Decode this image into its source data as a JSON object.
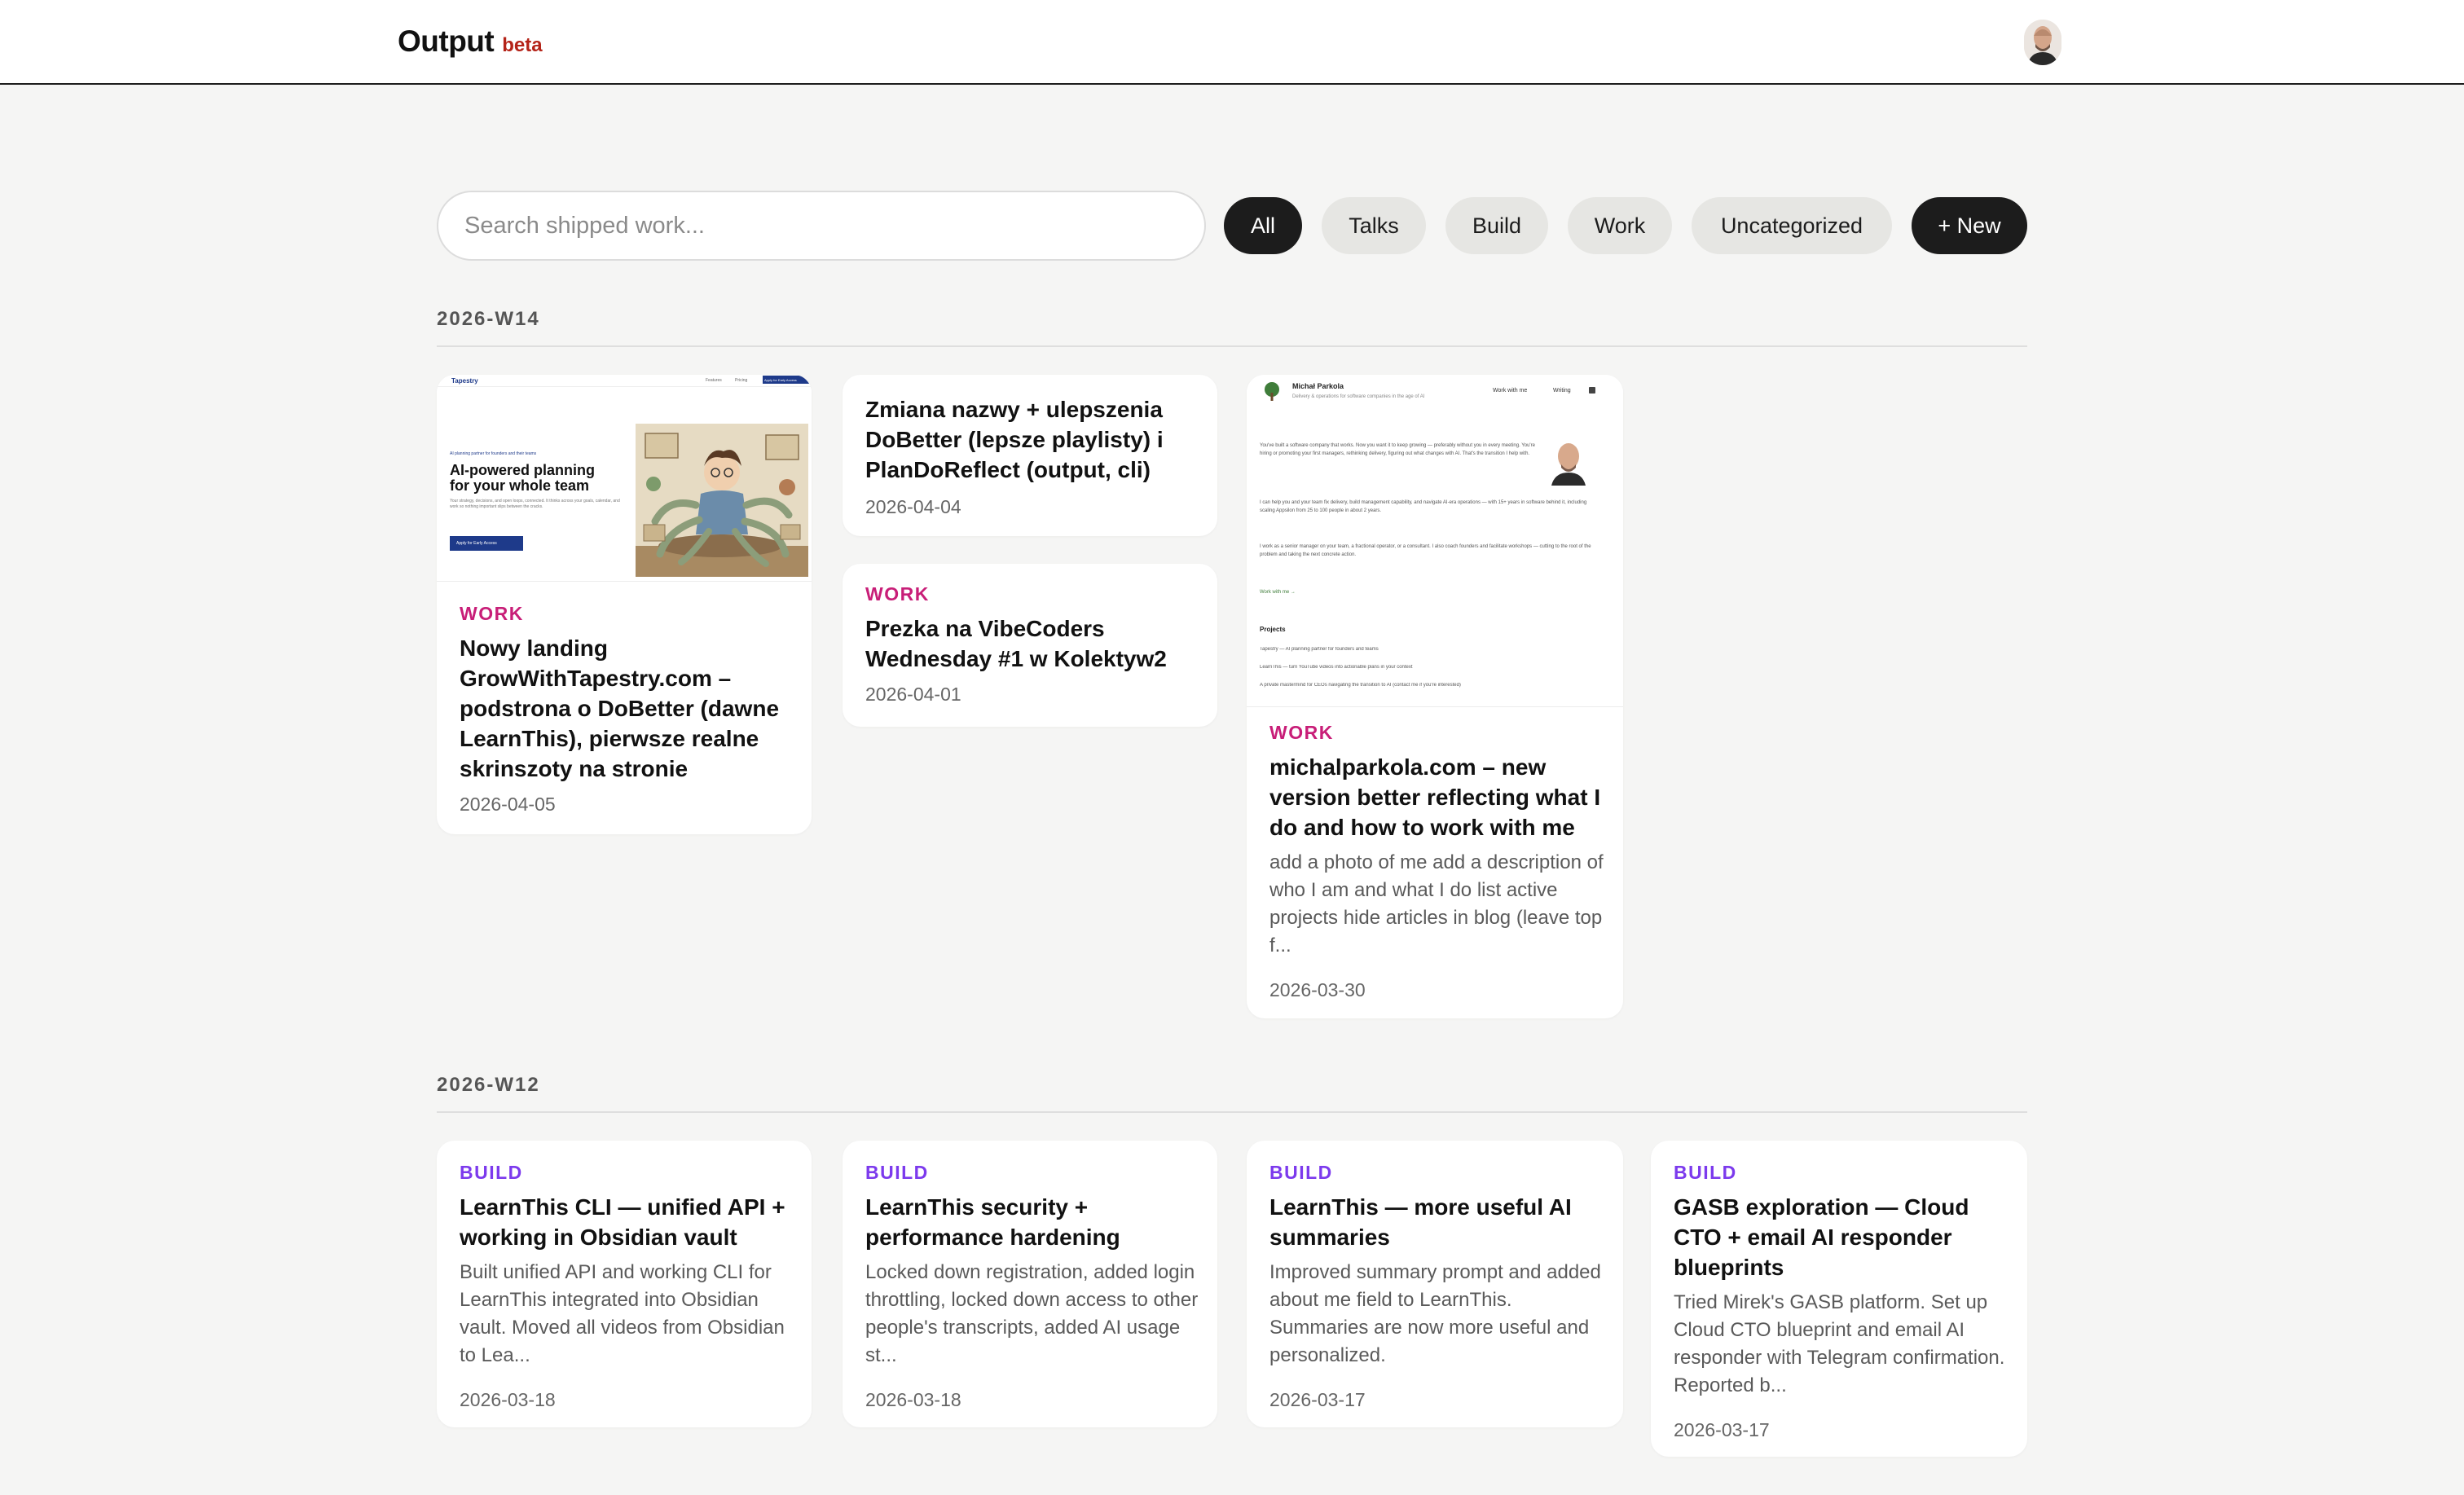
{
  "app": {
    "name": "Output",
    "badge": "beta"
  },
  "search": {
    "placeholder": "Search shipped work..."
  },
  "filters": [
    "All",
    "Talks",
    "Build",
    "Work",
    "Uncategorized"
  ],
  "new_button": "+ New",
  "colors": {
    "work": "#c81e78",
    "build": "#7c3aed",
    "active_chip": "#1c1c1c",
    "chip": "#e6e6e3",
    "beta": "#b42318"
  },
  "sections": [
    {
      "week": "2026-W14",
      "cards": [
        {
          "category": "WORK",
          "title": "Nowy landing GrowWithTapestry.com – podstrona o DoBetter (dawne LearnThis), pierwsze realne skrinszoty na stronie",
          "date": "2026-04-05",
          "thumbnail": {
            "brand": "Tapestry",
            "nav": [
              "Features",
              "Pricing",
              "Apply for Early Access"
            ],
            "eyebrow": "AI planning partner for founders and their teams",
            "heading": "AI-powered planning for your whole team",
            "body": "Your strategy, decisions, and open loops, connected. It thinks across your goals, calendar, and work so nothing important slips between the cracks.",
            "cta": "Apply for Early Access"
          }
        },
        {
          "category": "",
          "title": "Zmiana nazwy + ulepszenia DoBetter (lepsze playlisty) i PlanDoReflect (output, cli)",
          "date": "2026-04-04"
        },
        {
          "category": "WORK",
          "title": "Prezka na VibeCoders Wednesday #1 w Kolektyw2",
          "date": "2026-04-01"
        },
        {
          "category": "WORK",
          "title": "michalparkola.com – new version better reflecting what I do and how to work with me",
          "description": "add a photo of me add a description of who I am and what I do list active projects hide articles in blog (leave top f...",
          "date": "2026-03-30",
          "thumbnail": {
            "name": "Michał Parkola",
            "tagline": "Delivery & operations for software companies in the age of AI",
            "nav": [
              "Work with me",
              "Writing"
            ],
            "p1": "You've built a software company that works. Now you want it to keep growing — preferably without you in every meeting. You're hiring or promoting your first managers, rethinking delivery, figuring out what changes with AI. That's the transition I help with.",
            "p2": "I can help you and your team fix delivery, build management capability, and navigate AI-era operations — with 15+ years in software behind it, including scaling Appsilon from 25 to 100 people in about 2 years.",
            "p3": "I work as a senior manager on your team, a fractional operator, or a consultant. I also coach founders and facilitate workshops — cutting to the root of the problem and taking the next concrete action.",
            "link": "Work with me →",
            "projects_heading": "Projects",
            "projects": [
              "Tapestry — AI planning partner for founders and teams",
              "LearnThis — turn YouTube videos into actionable plans in your context",
              "A private mastermind for CEOs navigating the transition to AI (contact me if you're interested)"
            ]
          }
        }
      ]
    },
    {
      "week": "2026-W12",
      "cards": [
        {
          "category": "BUILD",
          "title": "LearnThis CLI — unified API + working in Obsidian vault",
          "description": "Built unified API and working CLI for LearnThis integrated into Obsidian vault. Moved all videos from Obsidian to Lea...",
          "date": "2026-03-18"
        },
        {
          "category": "BUILD",
          "title": "LearnThis security + performance hardening",
          "description": "Locked down registration, added login throttling, locked down access to other people's transcripts, added AI usage st...",
          "date": "2026-03-18"
        },
        {
          "category": "BUILD",
          "title": "LearnThis — more useful AI summaries",
          "description": "Improved summary prompt and added about me field to LearnThis. Summaries are now more useful and personalized.",
          "date": "2026-03-17"
        },
        {
          "category": "BUILD",
          "title": "GASB exploration — Cloud CTO + email AI responder blueprints",
          "description": "Tried Mirek's GASB platform. Set up Cloud CTO blueprint and email AI responder with Telegram confirmation. Reported b...",
          "date": "2026-03-17"
        }
      ]
    }
  ]
}
